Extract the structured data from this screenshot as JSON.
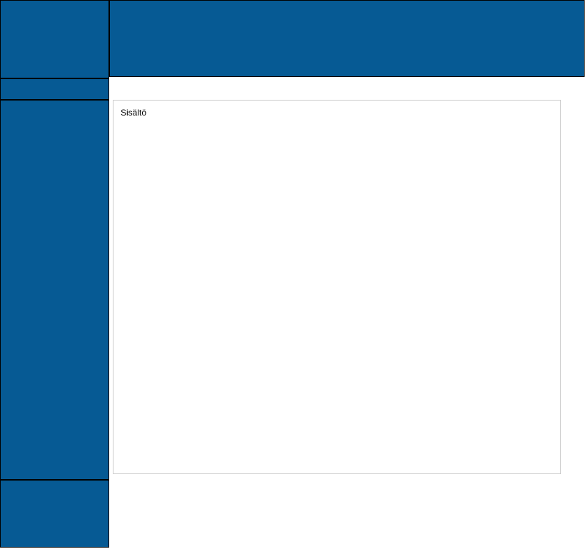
{
  "content": {
    "text": "Sisältö"
  },
  "colors": {
    "primary": "#065a94",
    "border": "#000000",
    "contentBorder": "#cccccc"
  }
}
